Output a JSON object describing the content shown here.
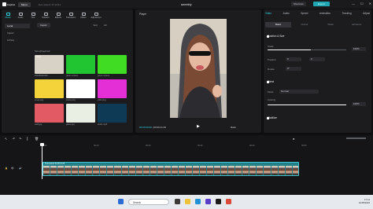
{
  "app": {
    "name": "CapCut",
    "menu_label": "Menu",
    "autosave": "Auto saved: 17:12:01",
    "project_title": "seeekly",
    "shortcuts_label": "Shortcuts",
    "export_label": "Export"
  },
  "media_tabs": [
    {
      "label": "Media"
    },
    {
      "label": "Audio"
    },
    {
      "label": "Text"
    },
    {
      "label": "Stickers"
    },
    {
      "label": "Effects"
    },
    {
      "label": "Transitions"
    },
    {
      "label": "Filters"
    },
    {
      "label": "Adjustment"
    }
  ],
  "media_sidebar": [
    "Local",
    "Import",
    "Library"
  ],
  "media_toolbar": {
    "import_label": "Import",
    "sort_label": "Sort",
    "all_label": "All"
  },
  "media_items": [
    {
      "name": "Sijmu@ragemed",
      "added": "",
      "color": "#1c1c1f"
    },
    {
      "name": "",
      "added": "",
      "color": "#1c1c1f"
    },
    {
      "name": "",
      "added": "",
      "color": "#1c1c1f"
    },
    {
      "name": "20220918-W0...",
      "added": "Added",
      "color": "#d8d2c6"
    },
    {
      "name": "green screen",
      "added": "",
      "color": "#21c431"
    },
    {
      "name": "green screen",
      "added": "",
      "color": "#3fdc23"
    },
    {
      "name": "emoji.png",
      "added": "",
      "color": "#f4d23a"
    },
    {
      "name": "frame.png",
      "added": "",
      "color": "#ffffff"
    },
    {
      "name": "color.png",
      "added": "",
      "color": "#e52fd6"
    },
    {
      "name": "card.jpg",
      "added": "",
      "color": "#e25a63"
    },
    {
      "name": "game.jpg",
      "added": "",
      "color": "#e9efe3"
    },
    {
      "name": "audio.mp3",
      "added": "",
      "color": "#0f3a55"
    }
  ],
  "player": {
    "label": "Player",
    "time_current": "00:00:00:00",
    "time_total": "00:00:11:26",
    "ratio_label": "Ratio"
  },
  "props": {
    "tabs": [
      "Video",
      "Audio",
      "Speed",
      "Animation",
      "Tracking",
      "Adjust"
    ],
    "sub_tabs": [
      "Basic",
      "Cutout",
      "Mask",
      "Enhance"
    ],
    "section_transform": "Position & Size",
    "scale_label": "Scale",
    "scale_value": "100%",
    "scale_level_pct": 55,
    "position_label": "Position",
    "pos_x": "0",
    "pos_y": "0",
    "rotate_label": "Rotate",
    "rotate_value": "0°",
    "section_blend": "Blend",
    "mode_label": "Mode",
    "mode_value": "Normal",
    "opacity_label": "Opacity",
    "opacity_value": "100%",
    "opacity_level_pct": 100,
    "section_stabilize": "Stabilize"
  },
  "timeline": {
    "ticks": [
      "00:00",
      "00:10",
      "00:20",
      "00:30",
      "00:40",
      "00:50"
    ],
    "clip_label": "Seeeeeked  00:00:11:26",
    "frames": 36
  },
  "taskbar": {
    "search_placeholder": "Search",
    "time": "17:12",
    "date": "10/05/2022"
  }
}
